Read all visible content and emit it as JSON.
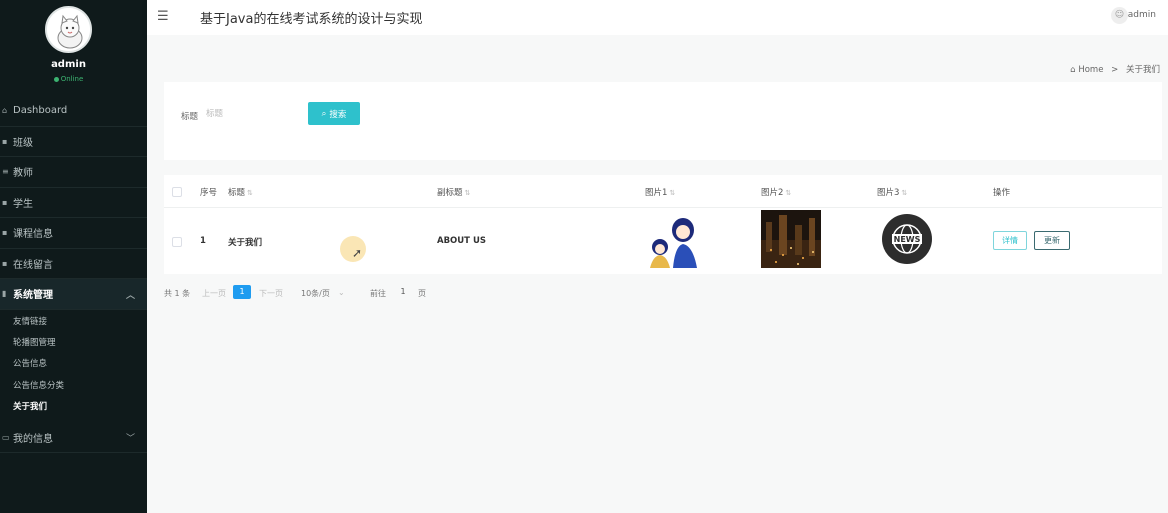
{
  "app": {
    "title": "基于Java的在线考试系统的设计与实现",
    "hamburger_icon": "☰",
    "top_user": "admin"
  },
  "user": {
    "name": "admin",
    "status": "Online"
  },
  "sidebar": {
    "items": [
      {
        "icon": "⌂",
        "label": "Dashboard"
      },
      {
        "icon": "▪",
        "label": "班级"
      },
      {
        "icon": "≡",
        "label": "教师"
      },
      {
        "icon": "▪",
        "label": "学生"
      },
      {
        "icon": "▪",
        "label": "课程信息"
      },
      {
        "icon": "▪",
        "label": "在线留言"
      },
      {
        "icon": "▮",
        "label": "系统管理"
      }
    ],
    "submenu": [
      "友情链接",
      "轮播图管理",
      "公告信息",
      "公告信息分类",
      "关于我们"
    ],
    "last_item": {
      "icon": "▭",
      "label": "我的信息"
    }
  },
  "breadcrumb": {
    "home": "Home",
    "current": "关于我们"
  },
  "search": {
    "label": "标题",
    "placeholder": "标题",
    "button": "搜索"
  },
  "table": {
    "headers": [
      "序号",
      "标题",
      "副标题",
      "图片1",
      "图片2",
      "图片3",
      "操作"
    ],
    "rows": [
      {
        "index": "1",
        "title": "关于我们",
        "subtitle": "ABOUT US",
        "img3_text": "NEWS",
        "detail": "详情",
        "update": "更新"
      }
    ]
  },
  "pagination": {
    "total": "共 1 条",
    "prev": "上一页",
    "page": "1",
    "next": "下一页",
    "page_size": "10条/页",
    "goto": "前往",
    "goto_page": "1",
    "page_unit": "页"
  },
  "colors": {
    "sidebar_bg": "#0f1a1b",
    "accent": "#2ec1cc",
    "pager_active": "#1f9cf0"
  }
}
